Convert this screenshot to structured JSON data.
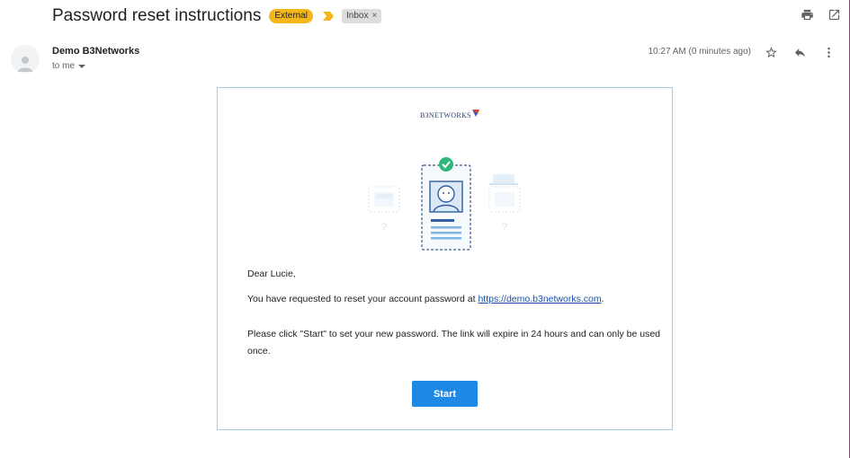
{
  "email": {
    "subject": "Password reset instructions",
    "labels": {
      "external": "External",
      "inbox": "Inbox",
      "inbox_remove": "×"
    },
    "sender_name": "Demo B3Networks",
    "recipient": "to me",
    "time": "10:27 AM (0 minutes ago)"
  },
  "icons": {
    "print": "print-icon",
    "open_new_window": "open-in-new-window-icon",
    "star": "star-icon",
    "reply": "reply-icon",
    "more": "more-vertical-icon",
    "avatar": "person-icon",
    "importance": "importance-marker-icon",
    "recipient_menu": "caret-down-icon"
  },
  "body": {
    "logo": "B3NETWORKS",
    "greeting": "Dear Lucie,",
    "request_text": "You have requested to reset your account password at ",
    "link": "https://demo.b3networks.com",
    "request_end": ".",
    "instructions": "Please click \"Start\" to set your new password. The link will expire in 24 hours and can only be used once.",
    "start_label": "Start"
  },
  "colors": {
    "external_badge": "#f5b619",
    "importance_marker": "#f5b619",
    "start_button": "#1e88e5",
    "card_border": "#9fd0e6",
    "link": "#1a4fa3",
    "check": "#2eb87a"
  }
}
